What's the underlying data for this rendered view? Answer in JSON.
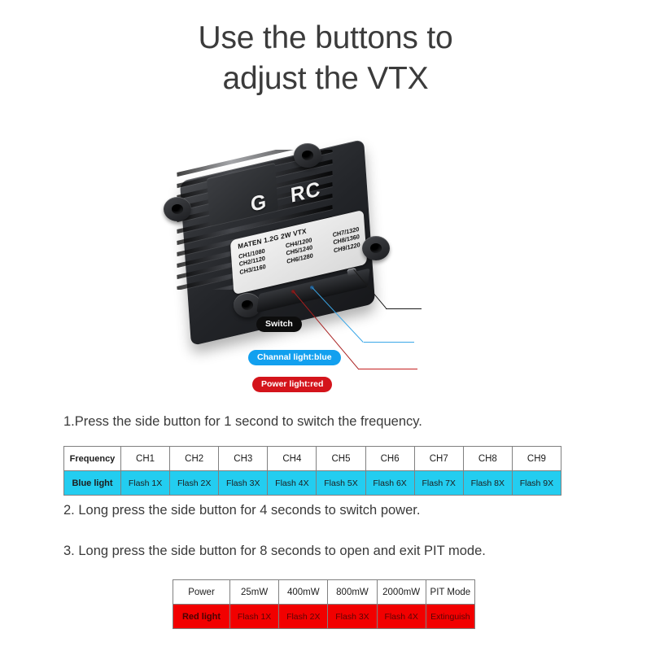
{
  "title": {
    "line1": "Use the buttons to",
    "line2": "adjust the VTX"
  },
  "product": {
    "brand_left": "G",
    "brand_right": "RC",
    "sticker_title": "MATEN 1.2G 2W VTX",
    "channels": [
      "CH1/1080",
      "CH4/1200",
      "CH7/1320",
      "CH2/1120",
      "CH5/1240",
      "CH8/1360",
      "CH3/1160",
      "CH6/1280",
      "CH9/1220"
    ],
    "callouts": {
      "switch": "Switch",
      "channel_light": "Channal light:blue",
      "power_light": "Power light:red"
    }
  },
  "instructions": {
    "step1": "1.Press the side button for 1 second to switch the frequency.",
    "step2": "2. Long press the side button for 4 seconds to switch power.",
    "step3": "3. Long press the side button for 8 seconds to open and exit PIT mode."
  },
  "frequency_table": {
    "row_labels": [
      "Frequency",
      "Blue light"
    ],
    "channels": [
      "CH1",
      "CH2",
      "CH3",
      "CH4",
      "CH5",
      "CH6",
      "CH7",
      "CH8",
      "CH9"
    ],
    "flashes": [
      "Flash 1X",
      "Flash 2X",
      "Flash 3X",
      "Flash 4X",
      "Flash 5X",
      "Flash 6X",
      "Flash 7X",
      "Flash 8X",
      "Flash 9X"
    ]
  },
  "power_table": {
    "row_labels": [
      "Power",
      "Red light"
    ],
    "levels": [
      "25mW",
      "400mW",
      "800mW",
      "2000mW",
      "PIT Mode"
    ],
    "flashes": [
      "Flash 1X",
      "Flash 2X",
      "Flash 3X",
      "Flash 4X",
      "Extinguish"
    ]
  },
  "colors": {
    "blue_light_cell": "#23cdf0",
    "red_light_cell": "#f20000",
    "callout_switch": "#0d0d0d",
    "callout_channel": "#12a0ef",
    "callout_power": "#d4141b",
    "title_text": "#3b3b3b"
  }
}
